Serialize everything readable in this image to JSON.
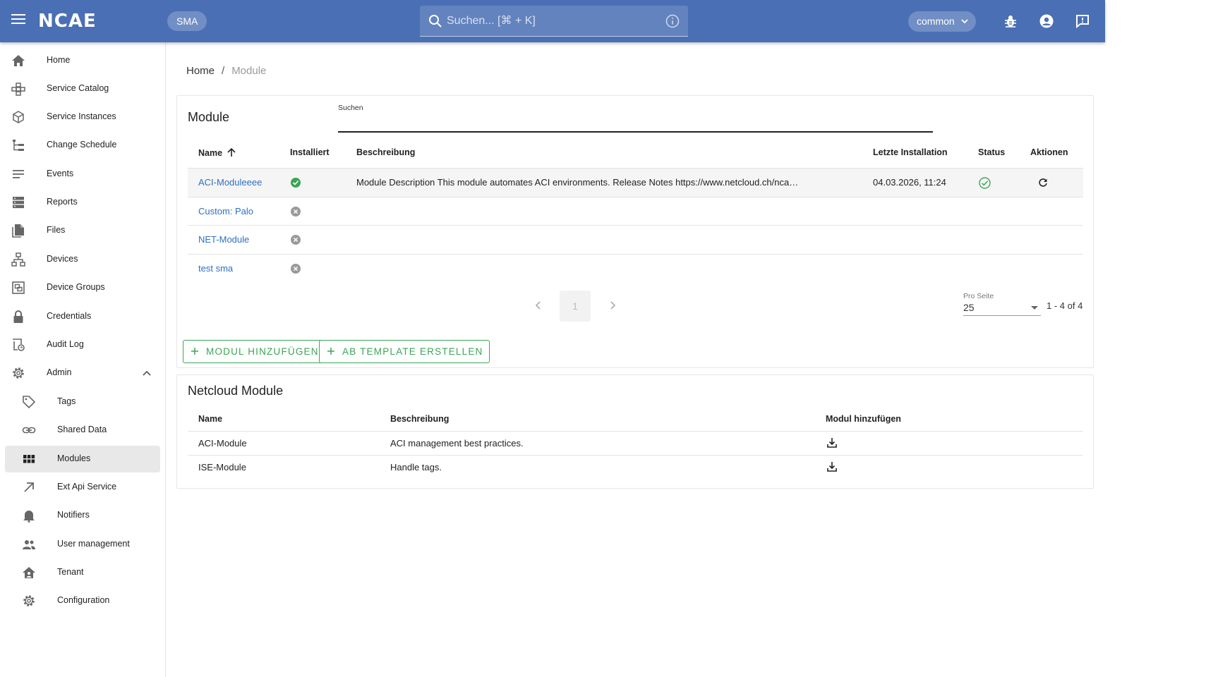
{
  "header": {
    "logo": "NCAE",
    "tenant_chip": "SMA",
    "search_placeholder": "Suchen... [⌘ + K]",
    "context_select": "common"
  },
  "sidebar": {
    "items": [
      {
        "label": "Home",
        "icon": "home-icon"
      },
      {
        "label": "Service Catalog",
        "icon": "service-catalog-icon"
      },
      {
        "label": "Service Instances",
        "icon": "cube-icon"
      },
      {
        "label": "Change Schedule",
        "icon": "tree-icon"
      },
      {
        "label": "Events",
        "icon": "list-icon"
      },
      {
        "label": "Reports",
        "icon": "storage-icon"
      },
      {
        "label": "Files",
        "icon": "files-icon"
      },
      {
        "label": "Devices",
        "icon": "network-icon"
      },
      {
        "label": "Device Groups",
        "icon": "device-groups-icon"
      },
      {
        "label": "Credentials",
        "icon": "lock-icon"
      },
      {
        "label": "Audit Log",
        "icon": "audit-log-icon"
      },
      {
        "label": "Admin",
        "icon": "gear-icon"
      }
    ],
    "admin_items": [
      {
        "label": "Tags",
        "icon": "tag-icon"
      },
      {
        "label": "Shared Data",
        "icon": "link-icon"
      },
      {
        "label": "Modules",
        "icon": "grid-icon"
      },
      {
        "label": "Ext Api Service",
        "icon": "arrow-up-right-icon"
      },
      {
        "label": "Notifiers",
        "icon": "bell-icon"
      },
      {
        "label": "User management",
        "icon": "users-icon"
      },
      {
        "label": "Tenant",
        "icon": "tenant-house-icon"
      },
      {
        "label": "Configuration",
        "icon": "gear-icon"
      }
    ]
  },
  "breadcrumb": {
    "home": "Home",
    "separator": "/",
    "current": "Module"
  },
  "modules_card": {
    "title": "Module",
    "search_label": "Suchen",
    "columns": [
      "Name",
      "Installiert",
      "Beschreibung",
      "Letzte Installation",
      "Status",
      "Aktionen"
    ],
    "rows": [
      {
        "name": "ACI-Moduleeee",
        "installed": true,
        "description": "Module Description This module automates ACI environments. Release Notes https://www.netcloud.ch/nca…",
        "last_install": "04.03.2026, 11:24",
        "status": "ok"
      },
      {
        "name": "Custom: Palo",
        "installed": false,
        "description": "",
        "last_install": "",
        "status": ""
      },
      {
        "name": "NET-Module",
        "installed": false,
        "description": "",
        "last_install": "",
        "status": ""
      },
      {
        "name": "test sma",
        "installed": false,
        "description": "",
        "last_install": "",
        "status": ""
      }
    ],
    "pagination": {
      "page": "1",
      "per_page_label": "Pro Seite",
      "per_page": "25",
      "range": "1 - 4 of 4"
    },
    "add_button": "Modul hinzufügen",
    "template_button": "Ab Template erstellen"
  },
  "netcloud_card": {
    "title": "Netcloud Module",
    "columns": [
      "Name",
      "Beschreibung",
      "Modul hinzufügen"
    ],
    "rows": [
      {
        "name": "ACI-Module",
        "description": "ACI management best practices."
      },
      {
        "name": "ISE-Module",
        "description": "Handle tags."
      }
    ]
  },
  "colors": {
    "topbar": "#4a6fb5",
    "accent_green": "#3aa655",
    "link": "#2f6fc2"
  }
}
